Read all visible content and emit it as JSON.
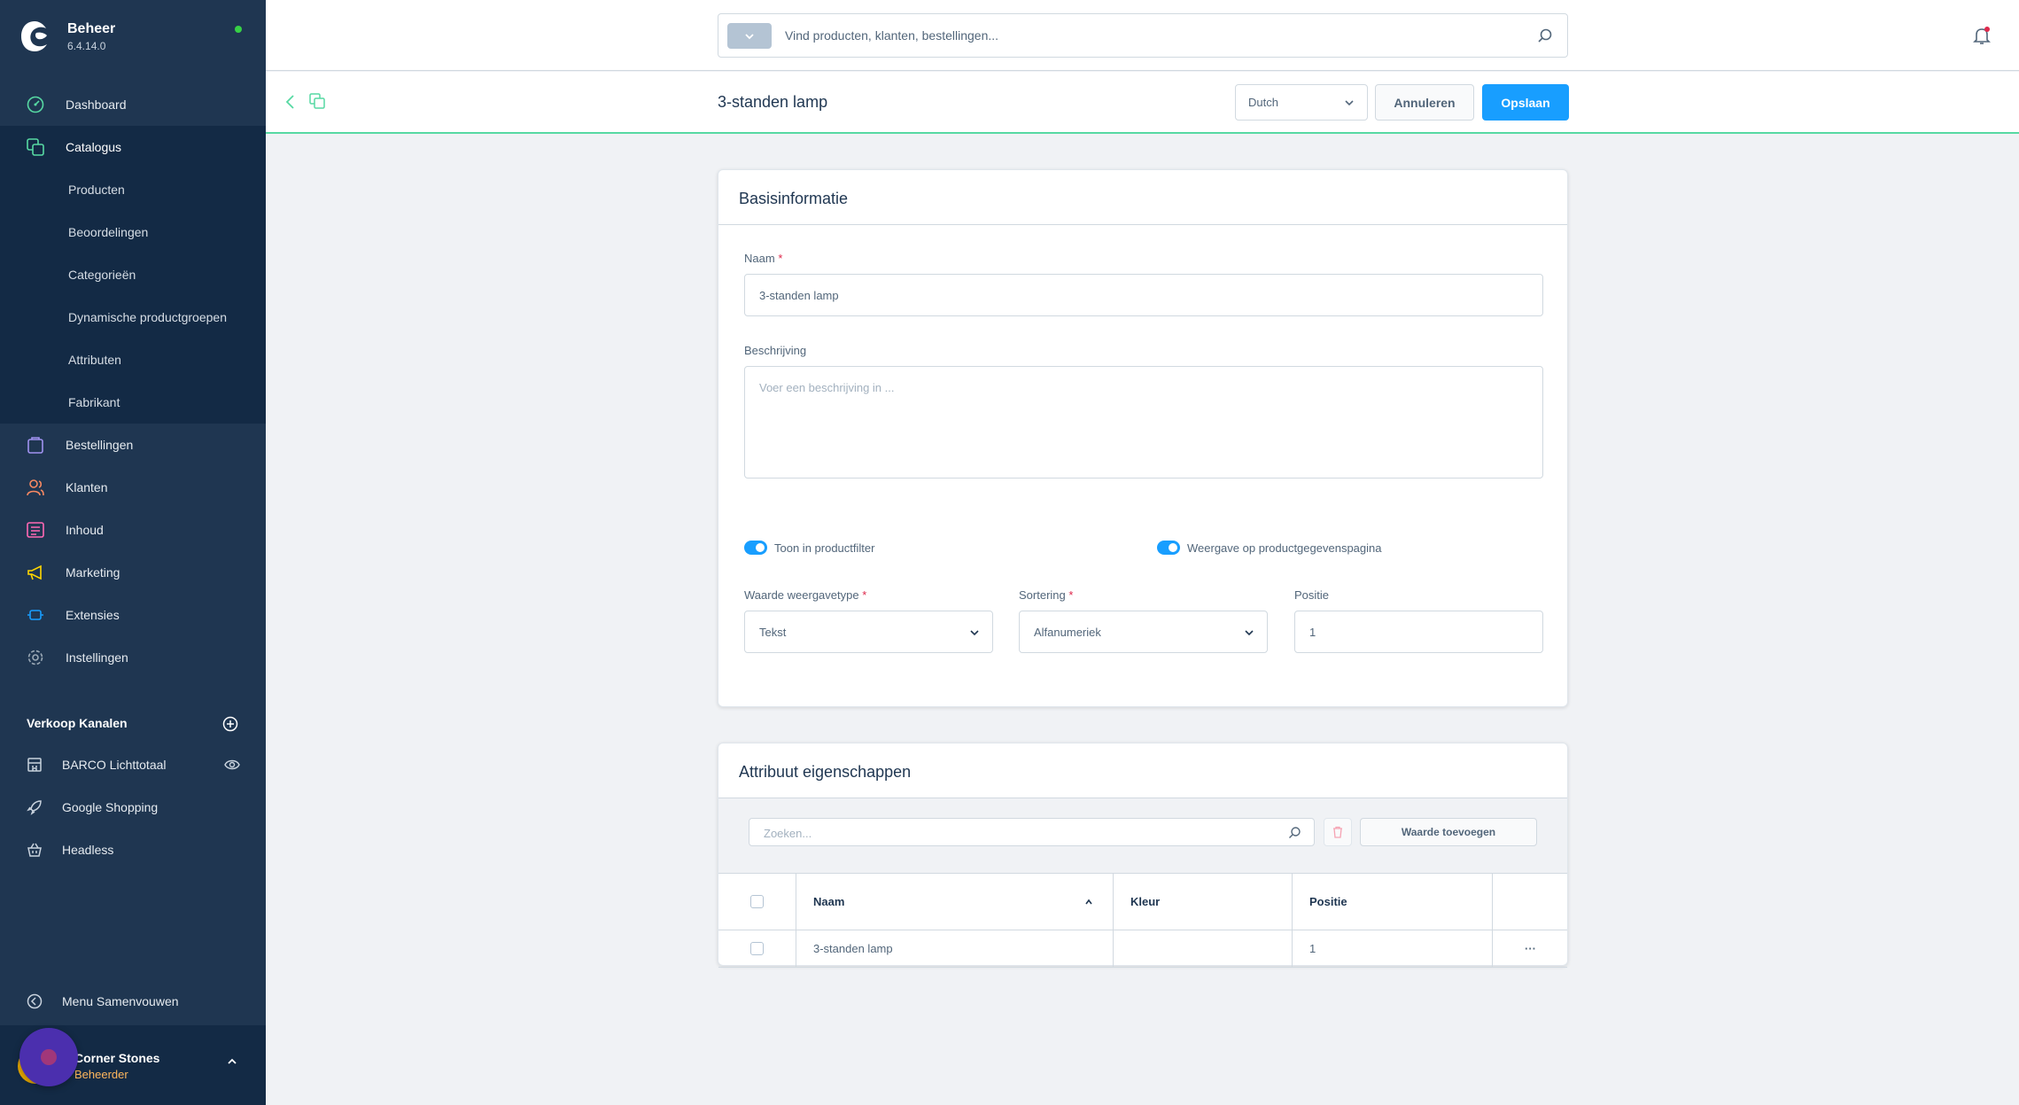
{
  "sidebar": {
    "brand_title": "Beheer",
    "brand_version": "6.4.14.0",
    "nav": [
      {
        "label": "Dashboard",
        "icon": "dashboard-icon",
        "color": "#57d9a3"
      },
      {
        "label": "Catalogus",
        "icon": "catalog-icon",
        "color": "#57d9a3"
      },
      {
        "label": "Bestellingen",
        "icon": "orders-icon",
        "color": "#a092f0"
      },
      {
        "label": "Klanten",
        "icon": "customers-icon",
        "color": "#f88962"
      },
      {
        "label": "Inhoud",
        "icon": "content-icon",
        "color": "#ff68b4"
      },
      {
        "label": "Marketing",
        "icon": "marketing-icon",
        "color": "#ffd700"
      },
      {
        "label": "Extensies",
        "icon": "extensions-icon",
        "color": "#189eff"
      },
      {
        "label": "Instellingen",
        "icon": "settings-icon",
        "color": "#9aa8b5"
      }
    ],
    "catalog_sub": [
      "Producten",
      "Beoordelingen",
      "Categorieën",
      "Dynamische productgroepen",
      "Attributen",
      "Fabrikant"
    ],
    "sales_channels_title": "Verkoop Kanalen",
    "sales_channels": [
      {
        "label": "BARCO Lichttotaal",
        "icon": "storefront-icon"
      },
      {
        "label": "Google Shopping",
        "icon": "rocket-icon"
      },
      {
        "label": "Headless",
        "icon": "basket-icon"
      }
    ],
    "collapse_label": "Menu Samenvouwen",
    "user_name": "Corner Stones",
    "user_role": "Beheerder"
  },
  "topbar": {
    "search_placeholder": "Vind producten, klanten, bestellingen..."
  },
  "actionbar": {
    "title": "3-standen lamp",
    "language": "Dutch",
    "cancel_label": "Annuleren",
    "save_label": "Opslaan"
  },
  "basic": {
    "title": "Basisinformatie",
    "name_label": "Naam",
    "name_value": "3-standen lamp",
    "desc_label": "Beschrijving",
    "desc_placeholder": "Voer een beschrijving in ...",
    "filter_toggle_label": "Toon in productfilter",
    "detail_toggle_label": "Weergave op productgegevenspagina",
    "display_type_label": "Waarde weergavetype",
    "display_type_value": "Tekst",
    "sorting_label": "Sortering",
    "sorting_value": "Alfanumeriek",
    "position_label": "Positie",
    "position_value": "1"
  },
  "options": {
    "title": "Attribuut eigenschappen",
    "search_placeholder": "Zoeken...",
    "add_label": "Waarde toevoegen",
    "columns": [
      "Naam",
      "Kleur",
      "Positie"
    ],
    "rows": [
      {
        "name": "3-standen lamp",
        "color": "",
        "position": "1",
        "actions": "···"
      }
    ]
  },
  "colors": {
    "sidebar": "#1f3651",
    "primary": "#189eff",
    "accent": "#57d9a3"
  }
}
